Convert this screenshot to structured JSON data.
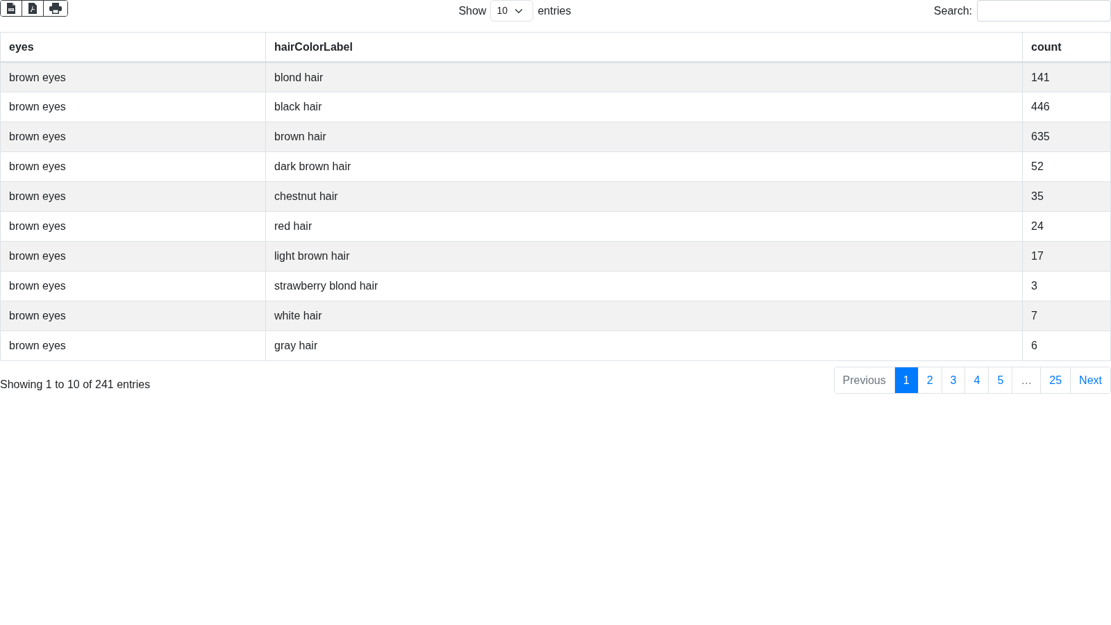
{
  "toolbar": {
    "buttons": [
      {
        "kind": "csv"
      },
      {
        "kind": "pdf"
      },
      {
        "kind": "print"
      }
    ]
  },
  "length": {
    "label_before": "Show",
    "value": "10",
    "label_after": "entries"
  },
  "search": {
    "label": "Search:"
  },
  "table": {
    "columns": [
      "eyes",
      "hairColorLabel",
      "count"
    ],
    "rows": [
      [
        "brown eyes",
        "blond hair",
        "141"
      ],
      [
        "brown eyes",
        "black hair",
        "446"
      ],
      [
        "brown eyes",
        "brown hair",
        "635"
      ],
      [
        "brown eyes",
        "dark brown hair",
        "52"
      ],
      [
        "brown eyes",
        "chestnut hair",
        "35"
      ],
      [
        "brown eyes",
        "red hair",
        "24"
      ],
      [
        "brown eyes",
        "light brown hair",
        "17"
      ],
      [
        "brown eyes",
        "strawberry blond hair",
        "3"
      ],
      [
        "brown eyes",
        "white hair",
        "7"
      ],
      [
        "brown eyes",
        "gray hair",
        "6"
      ]
    ]
  },
  "info": "Showing 1 to 10 of 241 entries",
  "pagination": [
    {
      "label": "Previous",
      "selected": false,
      "disabled": true
    },
    {
      "label": "1",
      "selected": true,
      "disabled": false
    },
    {
      "label": "2",
      "selected": false,
      "disabled": false
    },
    {
      "label": "3",
      "selected": false,
      "disabled": false
    },
    {
      "label": "4",
      "selected": false,
      "disabled": false
    },
    {
      "label": "5",
      "selected": false,
      "disabled": false
    },
    {
      "label": "…",
      "selected": false,
      "disabled": true
    },
    {
      "label": "25",
      "selected": false,
      "disabled": false
    },
    {
      "label": "Next",
      "selected": false,
      "disabled": false
    }
  ]
}
